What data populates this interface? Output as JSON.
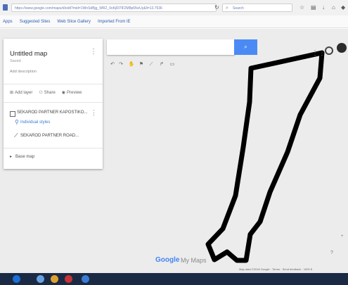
{
  "browser": {
    "url": "https://www.google.com/maps/d/edit?mid=1WnSdBjg_WR2_0oKjRl7lF2M8p6NzUy&ll=13.7536",
    "search_placeholder": "Search",
    "bookmarks": [
      "Apps",
      "Suggested Sites",
      "Web Slice Gallery",
      "Imported From IE"
    ]
  },
  "panel": {
    "title": "Untitled map",
    "subtitle": "Saved",
    "description": "Add description",
    "actions": [
      "Add layer",
      "Share",
      "Preview"
    ],
    "layer_name": "SEKAROD PARTNER KAPOSTIKO...",
    "style_link": "Individual styles",
    "item_name": "SEKAROD PARTNER ROAD...",
    "basemap_label": "Base map"
  },
  "footer": {
    "google_logo": "Google",
    "mymaps_label": "My Maps",
    "attribution": "Map data ©2018 Google · Terms · Send feedback · 1000 ft"
  },
  "icons": {
    "search": "search-icon",
    "apps": "apps-grid-icon",
    "pin": "location-pin-icon",
    "account": "account-avatar"
  },
  "colors": {
    "search_button": "#4b8af4",
    "route_line": "#000000"
  }
}
